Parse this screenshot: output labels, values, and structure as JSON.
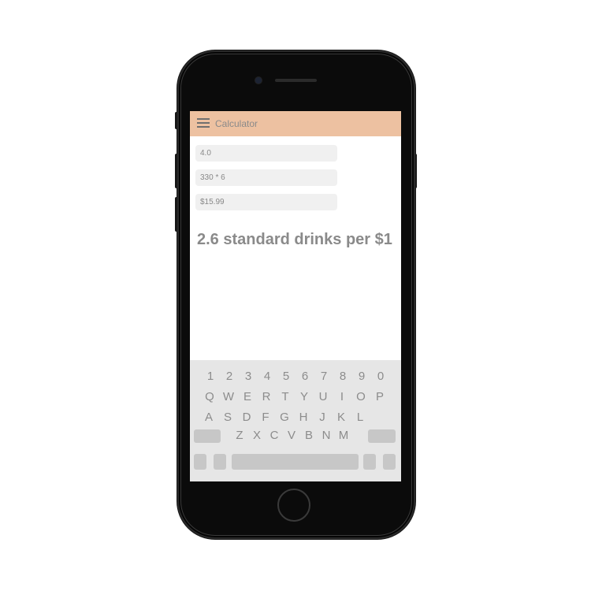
{
  "app": {
    "title": "Calculator"
  },
  "inputs": {
    "abv": "4.0",
    "volume": "330 * 6",
    "price": "$15.99"
  },
  "result": {
    "text": "2.6 standard drinks per $1"
  },
  "keyboard": {
    "number_row": [
      "1",
      "2",
      "3",
      "4",
      "5",
      "6",
      "7",
      "8",
      "9",
      "0"
    ],
    "row1": [
      "Q",
      "W",
      "E",
      "R",
      "T",
      "Y",
      "U",
      "I",
      "O",
      "P"
    ],
    "row2": [
      "A",
      "S",
      "D",
      "F",
      "G",
      "H",
      "J",
      "K",
      "L"
    ],
    "row3": [
      "Z",
      "X",
      "C",
      "V",
      "B",
      "N",
      "M"
    ]
  },
  "colors": {
    "header": "#edc1a1",
    "text_gray": "#8a8a8a",
    "field_bg": "#f0f0f0",
    "keyboard_bg": "#e6e6e6",
    "key_gray": "#c7c7c7",
    "phone_body": "#0b0b0b"
  },
  "icons": {
    "menu": "hamburger-menu-icon"
  }
}
